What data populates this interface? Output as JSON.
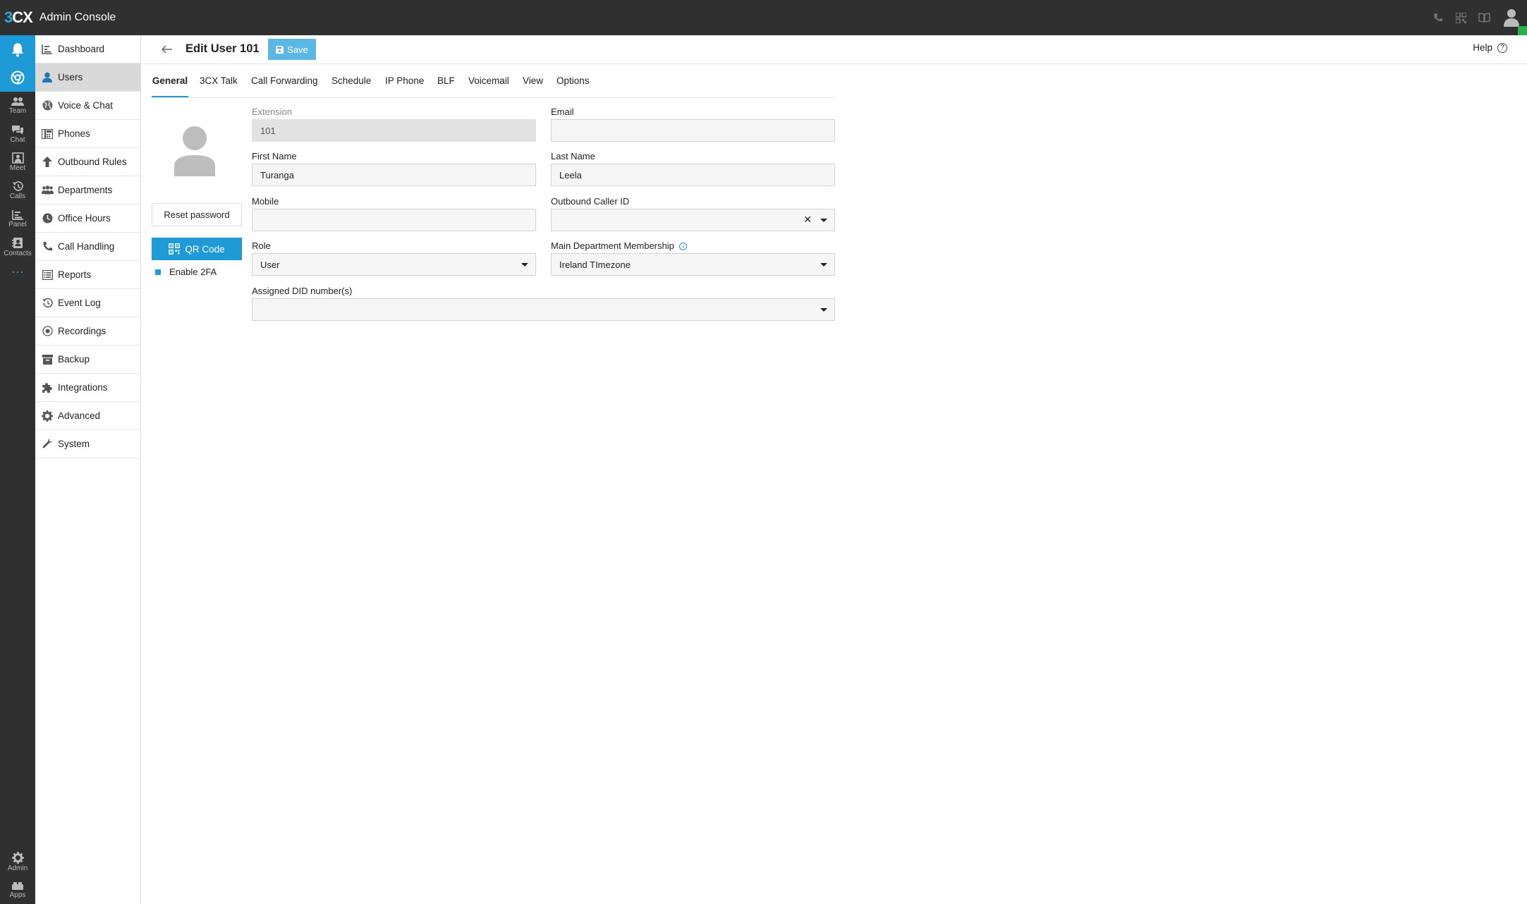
{
  "topbar": {
    "logo_a": "3",
    "logo_b": "CX",
    "title": "Admin Console",
    "icons": [
      "phone-icon",
      "qr-icon",
      "book-icon",
      "user-avatar-icon"
    ]
  },
  "rail": {
    "items": [
      {
        "icon": "bell-icon",
        "label": ""
      },
      {
        "icon": "chrome-icon",
        "label": ""
      },
      {
        "icon": "team-icon",
        "label": "Team"
      },
      {
        "icon": "chat-icon",
        "label": "Chat"
      },
      {
        "icon": "meet-icon",
        "label": "Meet"
      },
      {
        "icon": "calls-icon",
        "label": "Calls"
      },
      {
        "icon": "panel-icon",
        "label": "Panel"
      },
      {
        "icon": "contacts-icon",
        "label": "Contacts"
      }
    ],
    "more": "···",
    "bottom": [
      {
        "icon": "gear-icon",
        "label": "Admin"
      },
      {
        "icon": "apps-icon",
        "label": "Apps"
      }
    ]
  },
  "menu": {
    "items": [
      {
        "label": "Dashboard",
        "icon": "chart-icon"
      },
      {
        "label": "Users",
        "icon": "user-icon"
      },
      {
        "label": "Voice & Chat",
        "icon": "globe-icon"
      },
      {
        "label": "Phones",
        "icon": "phone-grid-icon"
      },
      {
        "label": "Outbound Rules",
        "icon": "arrow-up-icon"
      },
      {
        "label": "Departments",
        "icon": "group-icon"
      },
      {
        "label": "Office Hours",
        "icon": "clock-icon"
      },
      {
        "label": "Call Handling",
        "icon": "handset-icon"
      },
      {
        "label": "Reports",
        "icon": "list-icon"
      },
      {
        "label": "Event Log",
        "icon": "history-icon"
      },
      {
        "label": "Recordings",
        "icon": "record-icon"
      },
      {
        "label": "Backup",
        "icon": "archive-icon"
      },
      {
        "label": "Integrations",
        "icon": "puzzle-icon"
      },
      {
        "label": "Advanced",
        "icon": "cog-icon"
      },
      {
        "label": "System",
        "icon": "wrench-icon"
      }
    ]
  },
  "header": {
    "title": "Edit User 101",
    "save_label": "Save",
    "help_label": "Help"
  },
  "tabs": [
    "General",
    "3CX Talk",
    "Call Forwarding",
    "Schedule",
    "IP Phone",
    "BLF",
    "Voicemail",
    "View",
    "Options"
  ],
  "profile": {
    "reset_label": "Reset password",
    "qr_label": "QR Code",
    "twofa_label": "Enable 2FA"
  },
  "form": {
    "extension_label": "Extension",
    "extension_value": "101",
    "email_label": "Email",
    "email_value": "",
    "first_name_label": "First Name",
    "first_name_value": "Turanga",
    "last_name_label": "Last Name",
    "last_name_value": "Leela",
    "mobile_label": "Mobile",
    "mobile_value": "",
    "caller_id_label": "Outbound Caller ID",
    "caller_id_value": "",
    "role_label": "Role",
    "role_value": "User",
    "dept_label": "Main Department Membership",
    "dept_value": "Ireland TImezone",
    "did_label": "Assigned DID number(s)",
    "did_value": ""
  },
  "colors": {
    "accent": "#1e9ad6",
    "topbar": "#303030",
    "status": "#2ab24a"
  }
}
